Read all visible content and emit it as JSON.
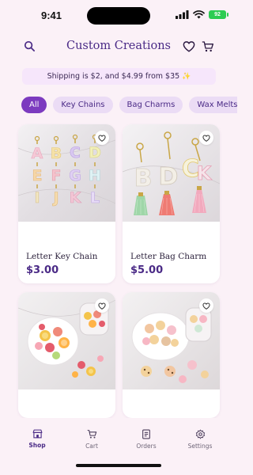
{
  "status_bar": {
    "time": "9:41",
    "battery_level": "92"
  },
  "header": {
    "title": "Custom Creations",
    "search_icon": "search-icon",
    "favorites_icon": "heart-icon",
    "cart_icon": "cart-icon"
  },
  "banner": {
    "text": "Shipping is $2, and $4.99 from $35",
    "emoji": "✨"
  },
  "categories": [
    "All",
    "Key Chains",
    "Bag Charms",
    "Wax Melts"
  ],
  "active_category": "All",
  "products": [
    {
      "name": "Letter Key Chain",
      "price": "$3.00"
    },
    {
      "name": "Letter Bag Charm",
      "price": "$5.00"
    },
    {
      "name": "",
      "price": ""
    },
    {
      "name": "",
      "price": ""
    }
  ],
  "tabs": [
    {
      "label": "Shop",
      "icon": "shop-icon"
    },
    {
      "label": "Cart",
      "icon": "cart-icon"
    },
    {
      "label": "Orders",
      "icon": "orders-icon"
    },
    {
      "label": "Settings",
      "icon": "gear-icon"
    }
  ],
  "colors": {
    "accent": "#7c3bbf",
    "brand": "#4a2a86",
    "background": "#fbf1f7"
  }
}
